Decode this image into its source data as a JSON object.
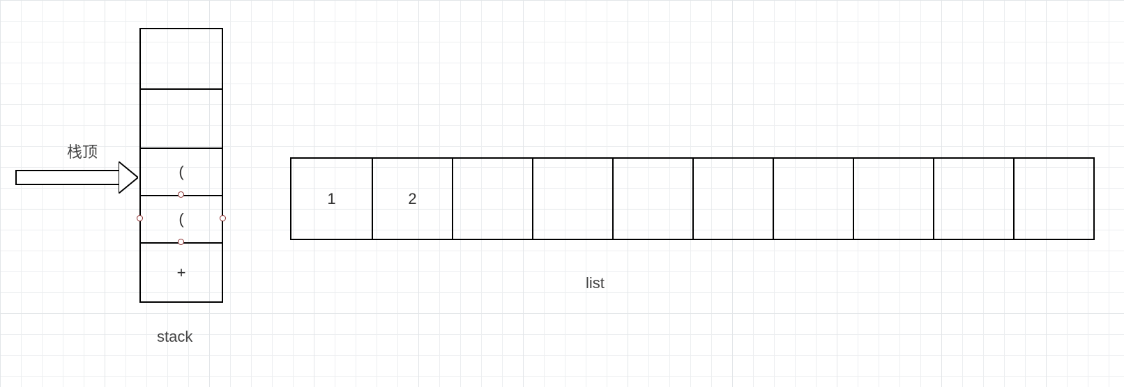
{
  "pointer_label": "栈顶",
  "stack": {
    "label": "stack",
    "cells": [
      "",
      "",
      "(",
      "(",
      "+"
    ]
  },
  "list": {
    "label": "list",
    "cells": [
      "1",
      "2",
      "",
      "",
      "",
      "",
      "",
      "",
      "",
      ""
    ]
  }
}
